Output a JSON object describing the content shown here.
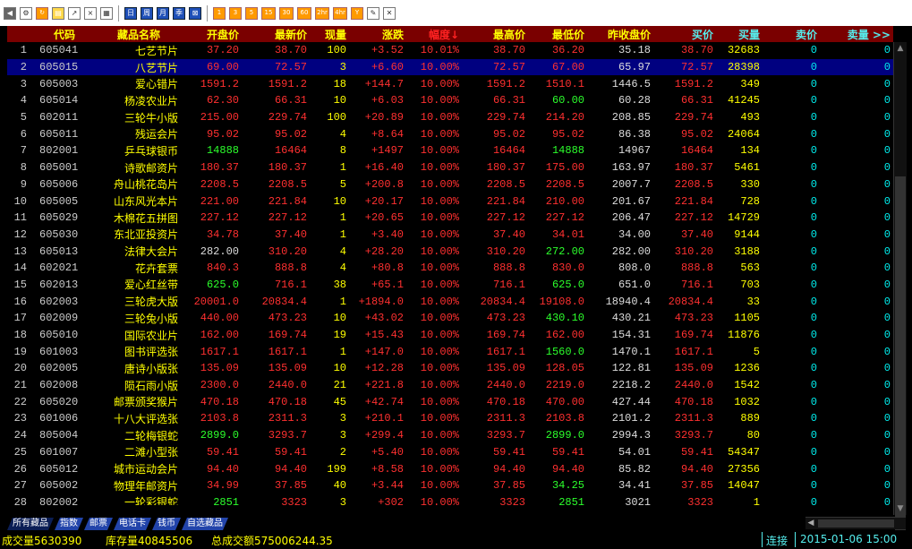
{
  "toolbar": {
    "buttons": [
      {
        "name": "back-icon",
        "glyph": "◀",
        "style": "gray"
      },
      {
        "name": "gear-icon",
        "glyph": "⚙",
        "style": "white"
      },
      {
        "name": "refresh-icon",
        "glyph": "↻",
        "style": "orange"
      },
      {
        "name": "clipboard-icon",
        "glyph": "▤",
        "style": "sel"
      },
      {
        "name": "line-chart-icon",
        "glyph": "↗",
        "style": "white"
      },
      {
        "name": "x-chart-icon",
        "glyph": "⨯",
        "style": "white"
      },
      {
        "name": "table-icon",
        "glyph": "▦",
        "style": "white"
      },
      {
        "name": "sep"
      },
      {
        "name": "day-button",
        "glyph": "日",
        "style": "blue"
      },
      {
        "name": "week-button",
        "glyph": "周",
        "style": "blue"
      },
      {
        "name": "month-button",
        "glyph": "月",
        "style": "blue"
      },
      {
        "name": "season-button",
        "glyph": "季",
        "style": "blue"
      },
      {
        "name": "crossed-box-icon",
        "glyph": "⊠",
        "style": "blue"
      },
      {
        "name": "sep"
      },
      {
        "name": "period-1-button",
        "glyph": "1",
        "style": "orange"
      },
      {
        "name": "period-3-button",
        "glyph": "3",
        "style": "orange"
      },
      {
        "name": "period-5-button",
        "glyph": "5",
        "style": "orange"
      },
      {
        "name": "period-15-button",
        "glyph": "15",
        "style": "orange"
      },
      {
        "name": "period-30-button",
        "glyph": "30",
        "style": "orange"
      },
      {
        "name": "period-60-button",
        "glyph": "60",
        "style": "orange"
      },
      {
        "name": "period-2hr-button",
        "glyph": "2hr",
        "style": "orange"
      },
      {
        "name": "period-4hr-button",
        "glyph": "4hr",
        "style": "orange"
      },
      {
        "name": "period-y-button",
        "glyph": "Y",
        "style": "orange"
      },
      {
        "name": "draw-icon",
        "glyph": "✎",
        "style": "white"
      },
      {
        "name": "close-tools-icon",
        "glyph": "✕",
        "style": "white"
      }
    ]
  },
  "columns": [
    "",
    "代码",
    "藏品名称",
    "开盘价",
    "最新价",
    "现量",
    "涨跌",
    "幅度↓",
    "最高价",
    "最低价",
    "昨收盘价",
    "买价",
    "买量",
    "卖价",
    "卖量 >>"
  ],
  "rows": [
    [
      "1",
      "605041",
      "七艺节片",
      "37.20",
      "38.70",
      "100",
      "+3.52",
      "10.01%",
      "38.70",
      "36.20",
      "35.18",
      "38.70",
      "32683",
      "0",
      "0"
    ],
    [
      "2",
      "605015",
      "八艺节片",
      "69.00",
      "72.57",
      "3",
      "+6.60",
      "10.00%",
      "72.57",
      "67.00",
      "65.97",
      "72.57",
      "28398",
      "0",
      "0"
    ],
    [
      "3",
      "605003",
      "爱心错片",
      "1591.2",
      "1591.2",
      "18",
      "+144.7",
      "10.00%",
      "1591.2",
      "1510.1",
      "1446.5",
      "1591.2",
      "349",
      "0",
      "0"
    ],
    [
      "4",
      "605014",
      "杨凌农业片",
      "62.30",
      "66.31",
      "10",
      "+6.03",
      "10.00%",
      "66.31",
      "60.00",
      "60.28",
      "66.31",
      "41245",
      "0",
      "0"
    ],
    [
      "5",
      "602011",
      "三轮牛小版",
      "215.00",
      "229.74",
      "100",
      "+20.89",
      "10.00%",
      "229.74",
      "214.20",
      "208.85",
      "229.74",
      "493",
      "0",
      "0"
    ],
    [
      "6",
      "605011",
      "残运会片",
      "95.02",
      "95.02",
      "4",
      "+8.64",
      "10.00%",
      "95.02",
      "95.02",
      "86.38",
      "95.02",
      "24064",
      "0",
      "0"
    ],
    [
      "7",
      "802001",
      "乒乓球银币",
      "14888",
      "16464",
      "8",
      "+1497",
      "10.00%",
      "16464",
      "14888",
      "14967",
      "16464",
      "134",
      "0",
      "0"
    ],
    [
      "8",
      "605001",
      "诗歌邮资片",
      "180.37",
      "180.37",
      "1",
      "+16.40",
      "10.00%",
      "180.37",
      "175.00",
      "163.97",
      "180.37",
      "5461",
      "0",
      "0"
    ],
    [
      "9",
      "605006",
      "舟山桃花岛片",
      "2208.5",
      "2208.5",
      "5",
      "+200.8",
      "10.00%",
      "2208.5",
      "2208.5",
      "2007.7",
      "2208.5",
      "330",
      "0",
      "0"
    ],
    [
      "10",
      "605005",
      "山东风光本片",
      "221.00",
      "221.84",
      "10",
      "+20.17",
      "10.00%",
      "221.84",
      "210.00",
      "201.67",
      "221.84",
      "728",
      "0",
      "0"
    ],
    [
      "11",
      "605029",
      "木棉花五拼图",
      "227.12",
      "227.12",
      "1",
      "+20.65",
      "10.00%",
      "227.12",
      "227.12",
      "206.47",
      "227.12",
      "14729",
      "0",
      "0"
    ],
    [
      "12",
      "605030",
      "东北亚投资片",
      "34.78",
      "37.40",
      "1",
      "+3.40",
      "10.00%",
      "37.40",
      "34.01",
      "34.00",
      "37.40",
      "9144",
      "0",
      "0"
    ],
    [
      "13",
      "605013",
      "法律大会片",
      "282.00",
      "310.20",
      "4",
      "+28.20",
      "10.00%",
      "310.20",
      "272.00",
      "282.00",
      "310.20",
      "3188",
      "0",
      "0"
    ],
    [
      "14",
      "602021",
      "花卉套票",
      "840.3",
      "888.8",
      "4",
      "+80.8",
      "10.00%",
      "888.8",
      "830.0",
      "808.0",
      "888.8",
      "563",
      "0",
      "0"
    ],
    [
      "15",
      "602013",
      "爱心红丝带",
      "625.0",
      "716.1",
      "38",
      "+65.1",
      "10.00%",
      "716.1",
      "625.0",
      "651.0",
      "716.1",
      "703",
      "0",
      "0"
    ],
    [
      "16",
      "602003",
      "三轮虎大版",
      "20001.0",
      "20834.4",
      "1",
      "+1894.0",
      "10.00%",
      "20834.4",
      "19108.0",
      "18940.4",
      "20834.4",
      "33",
      "0",
      "0"
    ],
    [
      "17",
      "602009",
      "三轮兔小版",
      "440.00",
      "473.23",
      "10",
      "+43.02",
      "10.00%",
      "473.23",
      "430.10",
      "430.21",
      "473.23",
      "1105",
      "0",
      "0"
    ],
    [
      "18",
      "605010",
      "国际农业片",
      "162.00",
      "169.74",
      "19",
      "+15.43",
      "10.00%",
      "169.74",
      "162.00",
      "154.31",
      "169.74",
      "11876",
      "0",
      "0"
    ],
    [
      "19",
      "601003",
      "图书评选张",
      "1617.1",
      "1617.1",
      "1",
      "+147.0",
      "10.00%",
      "1617.1",
      "1560.0",
      "1470.1",
      "1617.1",
      "5",
      "0",
      "0"
    ],
    [
      "20",
      "602005",
      "唐诗小版张",
      "135.09",
      "135.09",
      "10",
      "+12.28",
      "10.00%",
      "135.09",
      "128.05",
      "122.81",
      "135.09",
      "1236",
      "0",
      "0"
    ],
    [
      "21",
      "602008",
      "陨石雨小版",
      "2300.0",
      "2440.0",
      "21",
      "+221.8",
      "10.00%",
      "2440.0",
      "2219.0",
      "2218.2",
      "2440.0",
      "1542",
      "0",
      "0"
    ],
    [
      "22",
      "605020",
      "邮票颁奖猴片",
      "470.18",
      "470.18",
      "45",
      "+42.74",
      "10.00%",
      "470.18",
      "470.00",
      "427.44",
      "470.18",
      "1032",
      "0",
      "0"
    ],
    [
      "23",
      "601006",
      "十八大评选张",
      "2103.8",
      "2311.3",
      "3",
      "+210.1",
      "10.00%",
      "2311.3",
      "2103.8",
      "2101.2",
      "2311.3",
      "889",
      "0",
      "0"
    ],
    [
      "24",
      "805004",
      "二轮梅银蛇",
      "2899.0",
      "3293.7",
      "3",
      "+299.4",
      "10.00%",
      "3293.7",
      "2899.0",
      "2994.3",
      "3293.7",
      "80",
      "0",
      "0"
    ],
    [
      "25",
      "601007",
      "二滩小型张",
      "59.41",
      "59.41",
      "2",
      "+5.40",
      "10.00%",
      "59.41",
      "59.41",
      "54.01",
      "59.41",
      "54347",
      "0",
      "0"
    ],
    [
      "26",
      "605012",
      "城市运动会片",
      "94.40",
      "94.40",
      "199",
      "+8.58",
      "10.00%",
      "94.40",
      "94.40",
      "85.82",
      "94.40",
      "27356",
      "0",
      "0"
    ],
    [
      "27",
      "605002",
      "物理年邮资片",
      "34.99",
      "37.85",
      "40",
      "+3.44",
      "10.00%",
      "37.85",
      "34.25",
      "34.41",
      "37.85",
      "14047",
      "0",
      "0"
    ],
    [
      "28",
      "802002",
      "一轮彩银蛇",
      "2851",
      "3323",
      "3",
      "+302",
      "10.00%",
      "3323",
      "2851",
      "3021",
      "3323",
      "1",
      "0",
      "0"
    ]
  ],
  "row_colors": [
    [
      "red",
      "red",
      "red",
      "red",
      "red"
    ],
    [
      "red",
      "red",
      "red",
      "red",
      "red"
    ],
    [
      "red",
      "red",
      "red",
      "red",
      "red"
    ],
    [
      "red",
      "red",
      "red",
      "green",
      "red"
    ],
    [
      "red",
      "red",
      "red",
      "red",
      "red"
    ],
    [
      "red",
      "red",
      "red",
      "red",
      "red"
    ],
    [
      "green",
      "red",
      "red",
      "green",
      "red"
    ],
    [
      "red",
      "red",
      "red",
      "red",
      "red"
    ],
    [
      "red",
      "red",
      "red",
      "red",
      "red"
    ],
    [
      "red",
      "red",
      "red",
      "red",
      "red"
    ],
    [
      "red",
      "red",
      "red",
      "red",
      "red"
    ],
    [
      "red",
      "red",
      "red",
      "red",
      "red"
    ],
    [
      "white",
      "red",
      "red",
      "green",
      "red"
    ],
    [
      "red",
      "red",
      "red",
      "red",
      "red"
    ],
    [
      "green",
      "red",
      "red",
      "green",
      "red"
    ],
    [
      "red",
      "red",
      "red",
      "red",
      "red"
    ],
    [
      "red",
      "red",
      "red",
      "green",
      "red"
    ],
    [
      "red",
      "red",
      "red",
      "red",
      "red"
    ],
    [
      "red",
      "red",
      "red",
      "green",
      "red"
    ],
    [
      "red",
      "red",
      "red",
      "red",
      "red"
    ],
    [
      "red",
      "red",
      "red",
      "red",
      "red"
    ],
    [
      "red",
      "red",
      "red",
      "red",
      "red"
    ],
    [
      "red",
      "red",
      "red",
      "red",
      "red"
    ],
    [
      "green",
      "red",
      "red",
      "green",
      "red"
    ],
    [
      "red",
      "red",
      "red",
      "red",
      "red"
    ],
    [
      "red",
      "red",
      "red",
      "red",
      "red"
    ],
    [
      "red",
      "red",
      "red",
      "green",
      "red"
    ],
    [
      "green",
      "red",
      "red",
      "green",
      "red"
    ]
  ],
  "selected_row": 1,
  "tabs": [
    "所有藏品",
    "指数",
    "邮票",
    "电话卡",
    "钱币",
    "自选藏品"
  ],
  "status": {
    "volume": "成交量5630390",
    "stock": "库存量40845506",
    "total": "总成交额575006244.35",
    "conn": "连接",
    "time": "2015-01-06 15:00"
  }
}
